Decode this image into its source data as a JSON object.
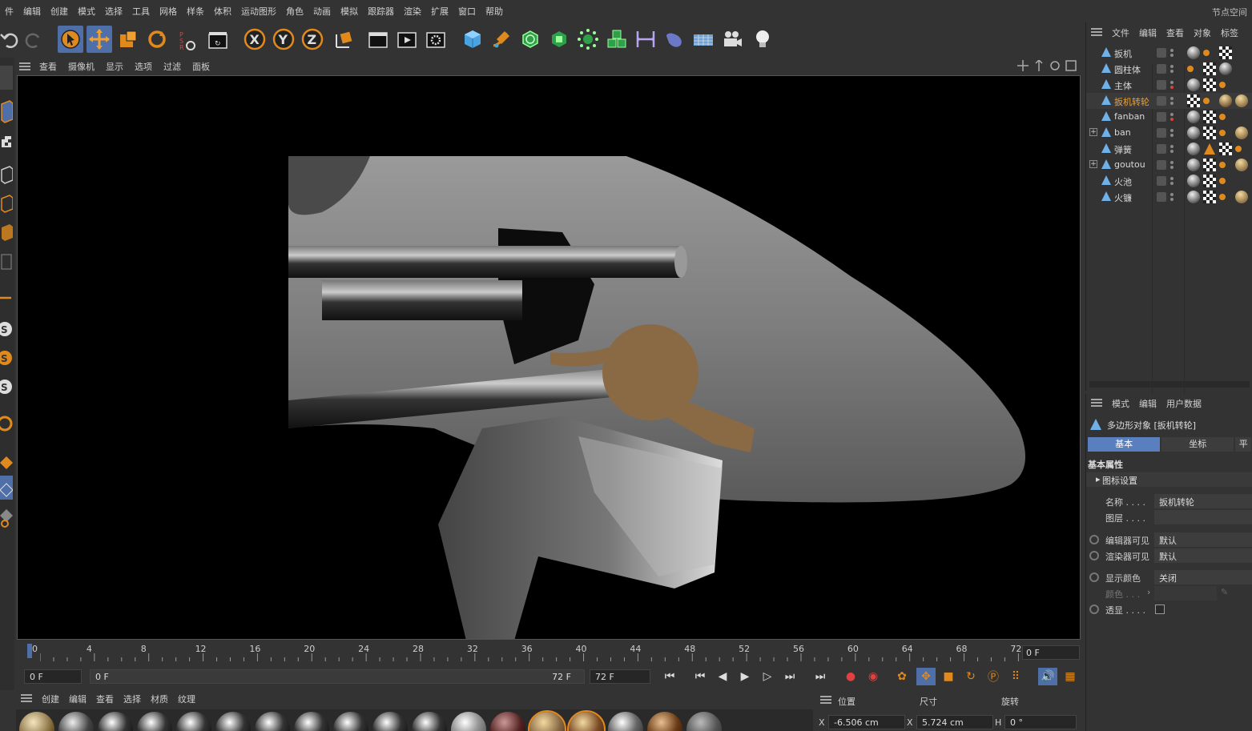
{
  "menu": {
    "items": [
      "件",
      "编辑",
      "创建",
      "模式",
      "选择",
      "工具",
      "网格",
      "样条",
      "体积",
      "运动图形",
      "角色",
      "动画",
      "模拟",
      "跟踪器",
      "渲染",
      "扩展",
      "窗口",
      "帮助"
    ],
    "right_label": "节点空间"
  },
  "toolbar": {
    "icons": [
      "undo-icon",
      "redo-icon",
      "select-icon",
      "move-icon",
      "scale-icon",
      "rotate-icon",
      "psr-icon",
      "clapper-icon",
      "axis-x-icon",
      "axis-y-icon",
      "axis-z-icon",
      "coord-system-icon",
      "render-view-icon",
      "render-icon",
      "render-settings-icon",
      "cube-icon",
      "pen-icon",
      "subdivide-icon",
      "extrude-icon",
      "array-icon",
      "clone-icon",
      "deformer-icon",
      "tag-icon",
      "floor-icon",
      "camera-icon",
      "light-icon"
    ],
    "axis_x": "X",
    "axis_y": "Y",
    "axis_z": "Z",
    "psr": "PSR"
  },
  "viewport_menu": {
    "items": [
      "查看",
      "摄像机",
      "显示",
      "选项",
      "过滤",
      "面板"
    ]
  },
  "timeline": {
    "ticks": [
      "0",
      "4",
      "8",
      "12",
      "16",
      "20",
      "24",
      "28",
      "32",
      "36",
      "40",
      "44",
      "48",
      "52",
      "56",
      "60",
      "64",
      "68",
      "72"
    ],
    "current_frame": "0 F",
    "range_start": "0 F",
    "range_bar_start": "0 F",
    "range_bar_end": "72 F",
    "range_end": "72 F"
  },
  "material_menu": {
    "items": [
      "创建",
      "编辑",
      "查看",
      "选择",
      "材质",
      "纹理"
    ]
  },
  "coord": {
    "position_label": "位置",
    "size_label": "尺寸",
    "rotation_label": "旋转",
    "x_label": "X",
    "x_value": "-6.506 cm",
    "x2_label": "X",
    "x2_value": "5.724 cm",
    "h_label": "H",
    "h_value": "0 °"
  },
  "object_manager": {
    "menu": [
      "文件",
      "编辑",
      "查看",
      "对象",
      "标签"
    ],
    "objects": [
      {
        "name": "扳机",
        "active": false
      },
      {
        "name": "圆柱体",
        "active": false
      },
      {
        "name": "主体",
        "active": false
      },
      {
        "name": "扳机转轮",
        "active": true
      },
      {
        "name": "fanban",
        "active": false
      },
      {
        "name": "ban",
        "active": false
      },
      {
        "name": "弹簧",
        "active": false
      },
      {
        "name": "goutou",
        "active": false
      },
      {
        "name": "火池",
        "active": false
      },
      {
        "name": "火镰",
        "active": false
      }
    ]
  },
  "attributes": {
    "menu": [
      "模式",
      "编辑",
      "用户数据"
    ],
    "object_title": "多边形对象 [扳机转轮]",
    "tabs": [
      "基本",
      "坐标",
      "平滑"
    ],
    "section": "基本属性",
    "subsection": "图标设置",
    "name_label": "名称 . . . .",
    "name_value": "扳机转轮",
    "layer_label": "图层 . . . .",
    "layer_value": "",
    "editor_vis_label": "编辑器可见",
    "editor_vis_value": "默认",
    "render_vis_label": "渲染器可见",
    "render_vis_value": "默认",
    "display_color_label": "显示颜色",
    "display_color_value": "关闭",
    "color_label": "颜色 . . .",
    "transparent_label": "透显 . . . ."
  },
  "colors": {
    "accent": "#4f6fa8",
    "active_object": "#f0a030",
    "background": "#333333"
  }
}
